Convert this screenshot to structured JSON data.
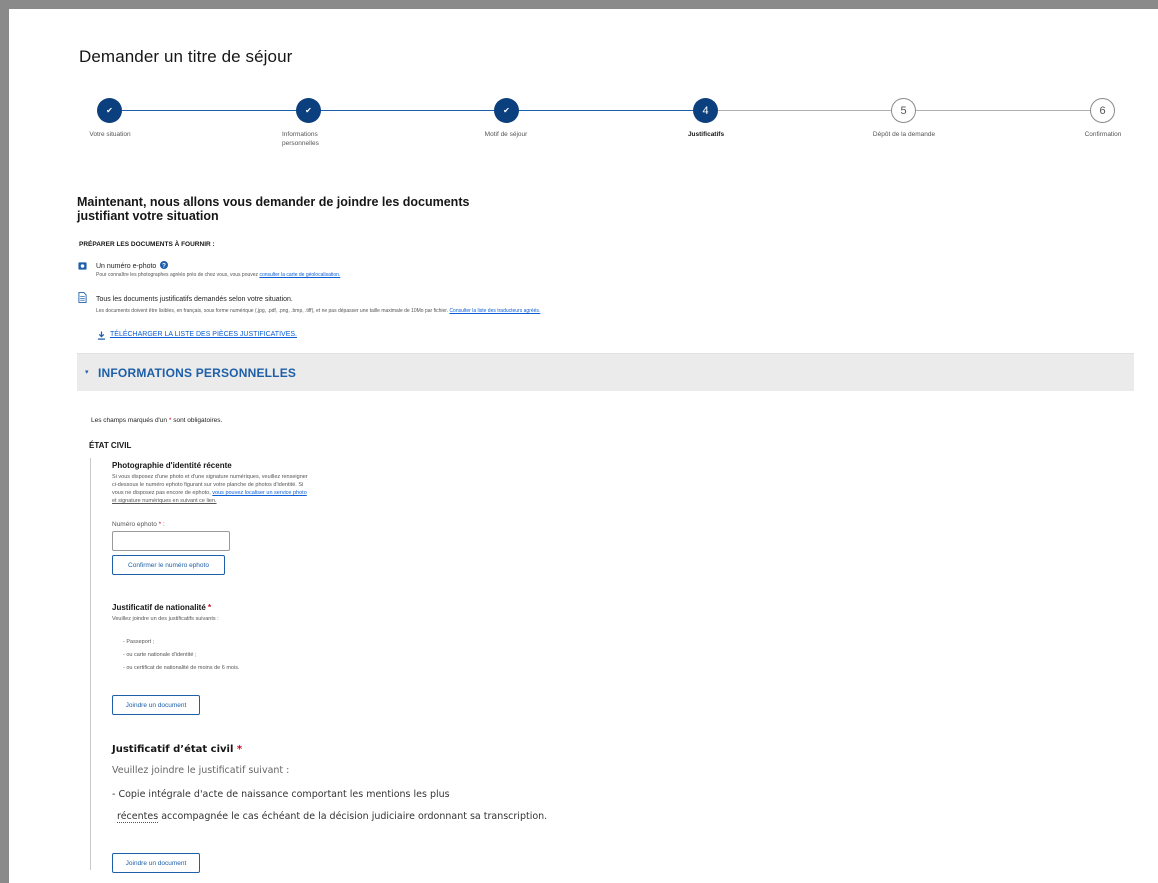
{
  "page": {
    "title": "Demander un titre de séjour"
  },
  "stepper": {
    "steps": [
      {
        "label": "Votre situation",
        "state": "done",
        "number": "✔"
      },
      {
        "label": "Informations personnelles",
        "state": "done",
        "number": "✔"
      },
      {
        "label": "Motif de séjour",
        "state": "done",
        "number": "✔"
      },
      {
        "label": "Justificatifs",
        "state": "active",
        "number": "4"
      },
      {
        "label": "Dépôt de la demande",
        "state": "todo",
        "number": "5"
      },
      {
        "label": "Confirmation",
        "state": "todo",
        "number": "6"
      }
    ]
  },
  "intro": {
    "title": "Maintenant, nous allons vous demander de joindre les documents justifiant votre situation",
    "prep_heading": "PRÉPARER LES DOCUMENTS À FOURNIR :",
    "ephoto": {
      "label": "Un numéro e-photo",
      "help_icon": "question-circle-icon",
      "sub_text": "Pour connaître les photographes agréés près de chez vous, vous pouvez",
      "sub_link": "consulter la carte de géolocalisation."
    },
    "justificatifs": {
      "label": "Tous les documents justificatifs demandés selon votre situation.",
      "sub_text": "Les documents doivent être lisibles, en français, sous forme numérique (.jpg, .pdf, .png, .bmp, .tiff), et ne pas dépasser une taille maximale de 10Mo par fichier.",
      "sub_link": "Consulter la liste des traducteurs agréés."
    },
    "download_label": "TÉLÉCHARGER LA LISTE DES PIÈCES JUSTIFICATIVES."
  },
  "section": {
    "title": "INFORMATIONS PERSONNELLES",
    "mandatory_prefix": "Les champs marqués d'un",
    "mandatory_star": "*",
    "mandatory_suffix": "sont obligatoires.",
    "etat_civil": "ÉTAT CIVIL"
  },
  "photo": {
    "title": "Photographie d'identité récente",
    "desc_1": "Si vous disposez d'une photo et d'une signature numériques, veuillez renseigner",
    "desc_2": "ci-dessous le numéro ephoto figurant sur votre planche de photos d'identité. Si",
    "desc_3_text": "vous ne disposez pas encore de ephoto,",
    "desc_3_link": "vous pouvez localiser un service photo",
    "desc_4_link": "et signature numériques en suivant ce lien.",
    "field_label": "Numéro ephoto",
    "field_star": "*",
    "field_colon": ":",
    "input_value": "",
    "confirm_button": "Confirmer le numéro ephoto"
  },
  "nationalite": {
    "title": "Justificatif de nationalité",
    "star": "*",
    "desc": "Veuillez joindre un des justificatifs suivants :",
    "items": [
      "- Passeport ;",
      "- ou carte nationale d'identité ;",
      "- ou certificat de nationalité de moins de 6 mois."
    ],
    "button": "Joindre un document"
  },
  "etat_civil_doc": {
    "title": "Justificatif d’état civil",
    "star": "*",
    "desc": "Veuillez joindre le justificatif suivant :",
    "line_1": "- Copie intégrale d'acte de naissance comportant les mentions les plus",
    "line_2_underlined": "récentes",
    "line_2_rest": "accompagnée le cas échéant de la décision judiciaire ordonnant sa transcription.",
    "button": "Joindre un document"
  },
  "colors": {
    "primary": "#0b3f7e",
    "link": "#0b5ed7",
    "required": "#d0021b",
    "section_bg": "#ebebeb"
  }
}
